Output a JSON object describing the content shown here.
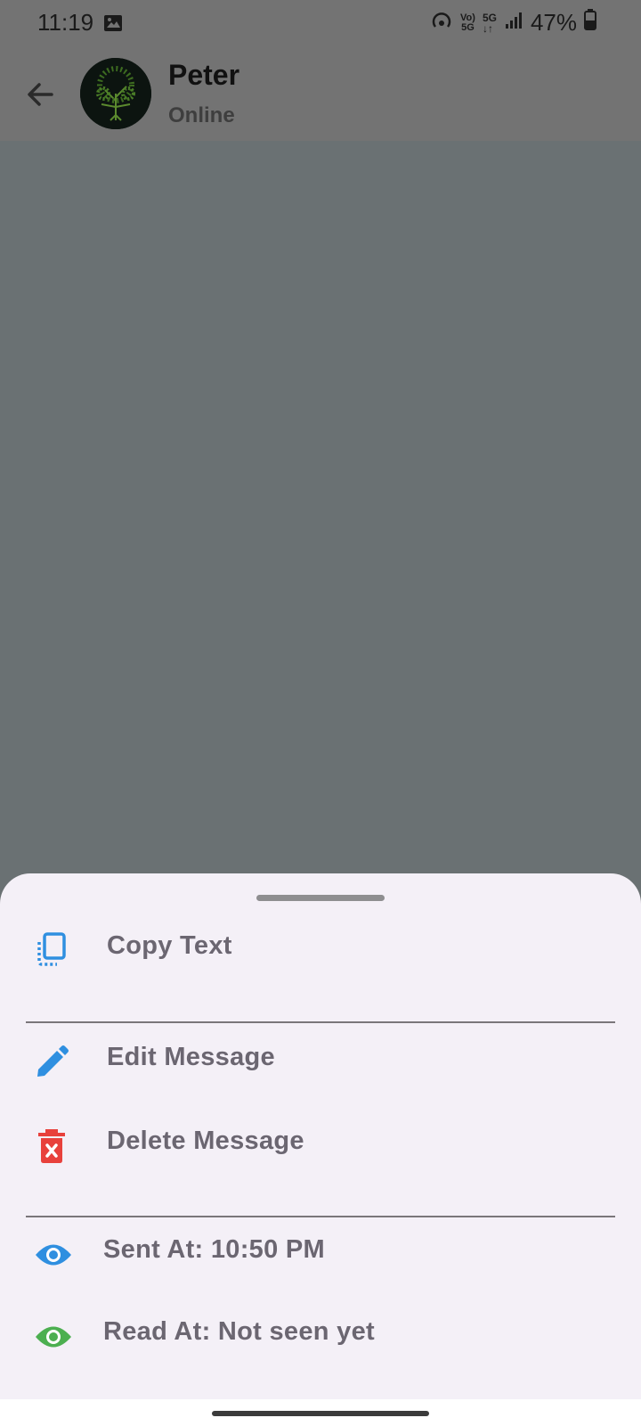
{
  "status_bar": {
    "time": "11:19",
    "battery": "47%"
  },
  "header": {
    "contact_name": "Peter",
    "status": "Online"
  },
  "sheet": {
    "items": [
      {
        "label": "Copy Text",
        "icon": "copy-icon",
        "color": "#2f8fe0"
      },
      {
        "label": "Edit Message",
        "icon": "edit-icon",
        "color": "#2f8fe0"
      },
      {
        "label": "Delete Message",
        "icon": "delete-icon",
        "color": "#e8413c"
      },
      {
        "label": "Sent At: 10:50 PM",
        "icon": "eye-icon",
        "color": "#2f8fe0"
      },
      {
        "label": "Read At: Not seen yet",
        "icon": "eye-icon",
        "color": "#4caf50"
      }
    ]
  }
}
